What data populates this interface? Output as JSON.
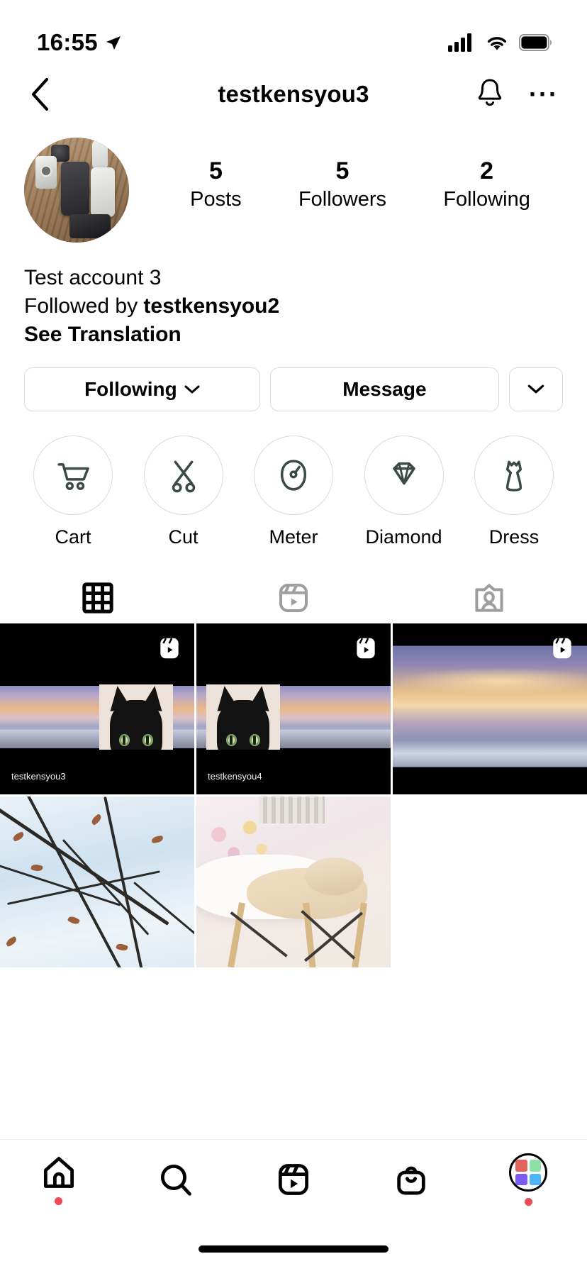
{
  "status_bar": {
    "time": "16:55",
    "location_icon": "location-arrow-icon",
    "cellular_icon": "cellular-signal-icon",
    "wifi_icon": "wifi-icon",
    "battery_icon": "battery-full-icon"
  },
  "nav": {
    "back_icon": "chevron-left-icon",
    "title": "testkensyou3",
    "notify_icon": "bell-icon",
    "more_icon": "ellipsis-icon"
  },
  "profile": {
    "avatar_name": "profile-photo",
    "stats": [
      {
        "num": "5",
        "label": "Posts"
      },
      {
        "num": "5",
        "label": "Followers"
      },
      {
        "num": "2",
        "label": "Following"
      }
    ],
    "bio": {
      "display_name": "Test account 3",
      "followed_by_prefix": "Followed by ",
      "followed_by_user": "testkensyou2",
      "see_translation": "See Translation"
    },
    "actions": {
      "following_label": "Following",
      "following_caret": "chevron-down-icon",
      "message_label": "Message",
      "more_caret": "chevron-down-icon"
    }
  },
  "highlights": [
    {
      "label": "Cart",
      "icon": "cart-icon"
    },
    {
      "label": "Cut",
      "icon": "scissors-icon"
    },
    {
      "label": "Meter",
      "icon": "meter-icon"
    },
    {
      "label": "Diamond",
      "icon": "diamond-icon"
    },
    {
      "label": "Dress",
      "icon": "dress-icon"
    }
  ],
  "tabs": [
    {
      "name": "grid",
      "icon": "grid-icon",
      "active": true
    },
    {
      "name": "reels",
      "icon": "reels-icon",
      "active": false
    },
    {
      "name": "tagged",
      "icon": "tagged-icon",
      "active": false
    }
  ],
  "grid": {
    "posts": [
      {
        "kind": "reel",
        "badge": "reels-badge-icon",
        "watermark": "testkensyou3"
      },
      {
        "kind": "reel",
        "badge": "reels-badge-icon",
        "watermark": "testkensyou4"
      },
      {
        "kind": "reel-sunset",
        "badge": "reels-badge-icon",
        "watermark": ""
      },
      {
        "kind": "photo-branches",
        "badge": "",
        "watermark": ""
      },
      {
        "kind": "photo-cat",
        "badge": "",
        "watermark": ""
      },
      {
        "kind": "empty",
        "badge": "",
        "watermark": ""
      }
    ]
  },
  "bottom_nav": [
    {
      "name": "home",
      "icon": "home-icon",
      "badge_dot": true
    },
    {
      "name": "search",
      "icon": "search-icon",
      "badge_dot": false
    },
    {
      "name": "reels",
      "icon": "reels-icon",
      "badge_dot": false
    },
    {
      "name": "shop",
      "icon": "shopping-bag-icon",
      "badge_dot": false
    },
    {
      "name": "profile",
      "icon": "profile-avatar-icon",
      "badge_dot": true
    }
  ],
  "colors": {
    "accent_red": "#ed4956",
    "border": "#dbdbdb",
    "icon_dark": "#3c4a45",
    "tab_inactive": "#9e9e9e",
    "avatar_tl": "#e0635e",
    "avatar_tr": "#8fe0a8",
    "avatar_bl": "#7b5cf0",
    "avatar_br": "#4fb3f7"
  }
}
